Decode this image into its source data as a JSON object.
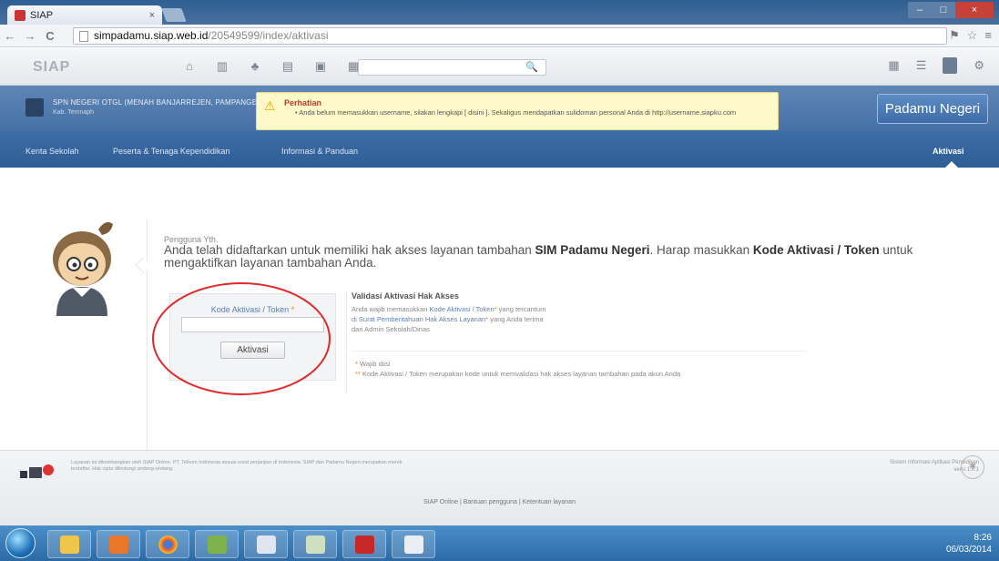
{
  "browser": {
    "tab_title": "SIAP",
    "tab_close": "×",
    "url_host": "simpadamu.siap.web.id",
    "url_path": "/20549599/index/aktivasi",
    "back": "←",
    "forward": "→",
    "reload": "C",
    "window_min": "–",
    "window_max": "□",
    "window_close": "×"
  },
  "siap_toolbar": {
    "logo": "SIAP",
    "search_icon": "🔍"
  },
  "header": {
    "school_name": "SPN NEGERI OTGL (MENAH BANJARREJEN, PAMPANGEL)",
    "school_sub": "Kab. Temnaph",
    "notice_title": "Perhatian",
    "notice_body": "• Anda belum memasukkan username, silakan lengkapi [ disini ]. Sekaligus mendapatkan sulidoman personal Anda di http://username.siapku.com",
    "brand_button": "Padamu Negeri"
  },
  "menu": {
    "items": [
      "Kenta Sekolah",
      "Peserta & Tenaga Kependidikan",
      "Informasi & Panduan"
    ],
    "active": "Aktivasi"
  },
  "content": {
    "greeting": "Pengguna Yth.",
    "msg_part1": "Anda telah didaftarkan untuk memiliki hak akses layanan tambahan ",
    "msg_bold1": "SIM Padamu Negeri",
    "msg_part2": ". Harap masukkan ",
    "msg_bold2": "Kode Aktivasi / Token",
    "msg_part3": " untuk mengaktifkan layanan tambahan Anda."
  },
  "form": {
    "label": "Kode Aktivasi / Token",
    "required_mark": "*",
    "input_value": "",
    "input_placeholder": "",
    "submit_label": "Aktivasi"
  },
  "validation": {
    "heading": "Validasi Aktivasi Hak Akses",
    "line1_pre": "Anda wajib memasukkan ",
    "line1_link": "Kode Aktivasi / Token",
    "line1_post": " yang tercantum",
    "line2_pre": "di ",
    "line2_link": "Surat Pemberitahuan Hak Akses Layanan",
    "line2_post": " yang Anda terima",
    "line3": "dari Admin Sekolah/Dinas",
    "note1": "Wajib diisi",
    "note2_pre": " ",
    "note2": "Kode Aktivasi / Token merupakan kode untuk memvalidasi hak akses layanan tambahan pada akun Anda"
  },
  "footer": {
    "left_text": "Layanan ini dikembangkan oleh SIAP Online. PT. Telkom Indonesia sesuai surat perjanjian di Indonesia. SIAP dan Padamu Negeri merupakan merek terdaftar. Hak cipta dilindungi undang-undang.",
    "right_text": "Sistem Informasi Aplikasi Pendidikan versi 1.0.1",
    "links": "SIAP Online  |  Bantuan pengguna  |  Ketentuan layanan"
  },
  "taskbar": {
    "time": "8:26",
    "date": "06/03/2014"
  },
  "colors": {
    "header_blue": "#4671a6",
    "menu_blue": "#305d95",
    "notice_yellow": "#fdf9c8",
    "annotation_red": "#e0282a",
    "required_orange": "#e67e22"
  }
}
